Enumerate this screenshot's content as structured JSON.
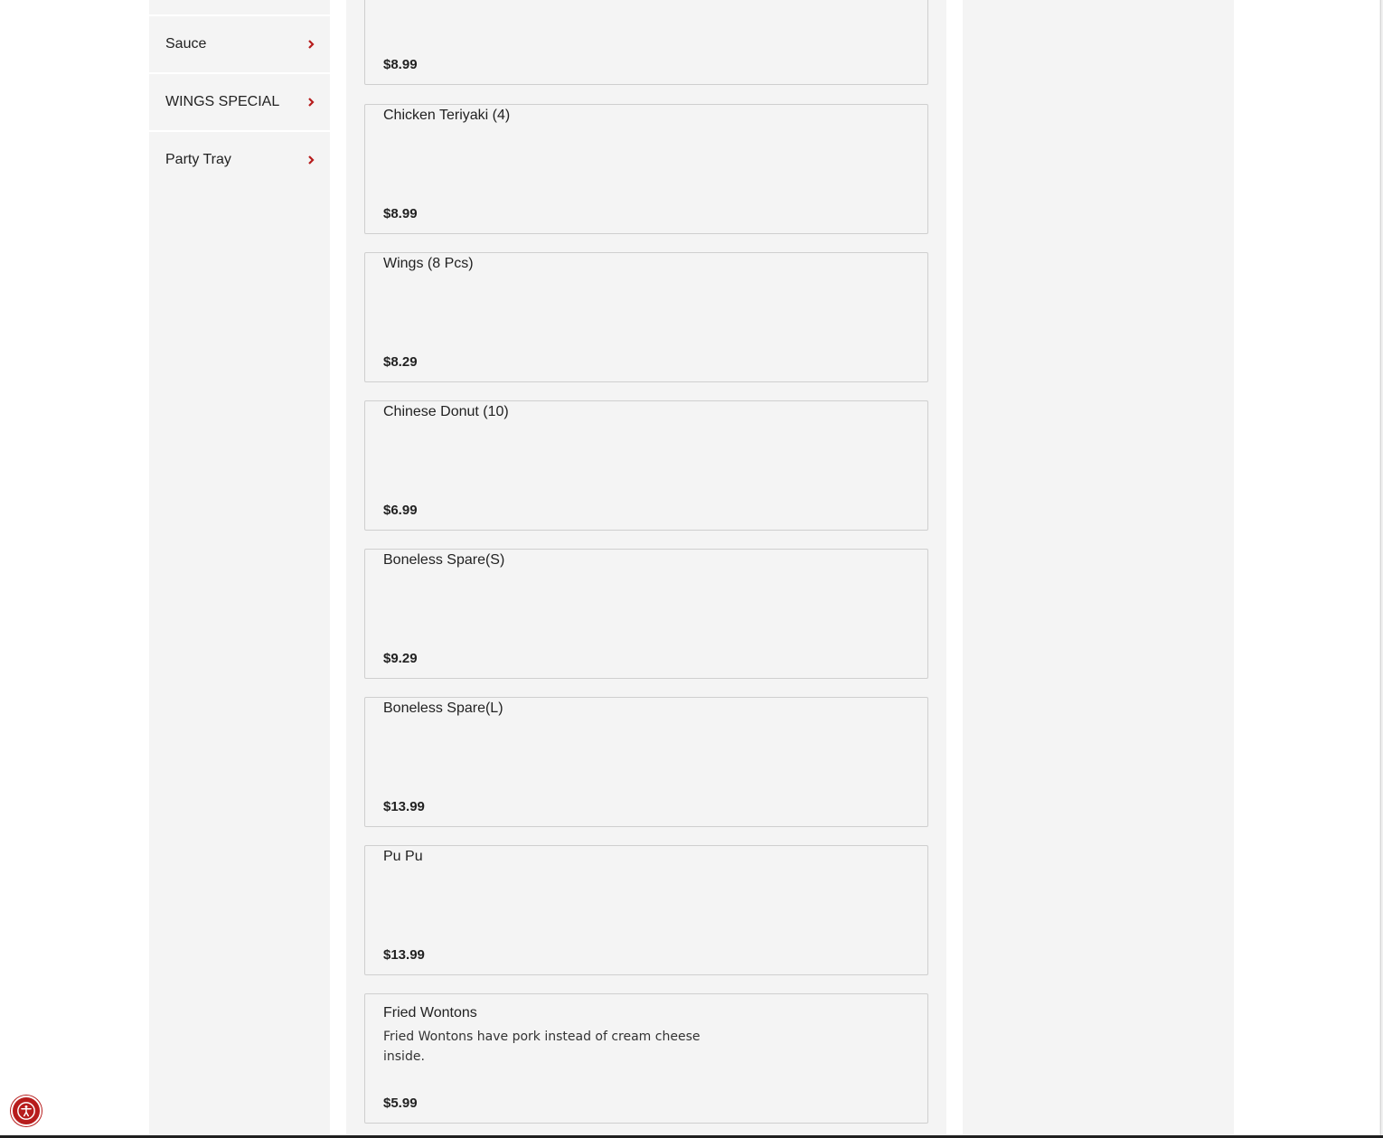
{
  "sidebar": {
    "categories": [
      {
        "label": "Sauce"
      },
      {
        "label": "WINGS SPECIAL"
      },
      {
        "label": "Party Tray"
      }
    ]
  },
  "menu": {
    "items": [
      {
        "name": "",
        "description": "",
        "price": "$8.99"
      },
      {
        "name": "Chicken Teriyaki (4)",
        "description": "",
        "price": "$8.99"
      },
      {
        "name": "Wings (8 Pcs)",
        "description": "",
        "price": "$8.29"
      },
      {
        "name": "Chinese Donut (10)",
        "description": "",
        "price": "$6.99"
      },
      {
        "name": "Boneless Spare(S)",
        "description": "",
        "price": "$9.29"
      },
      {
        "name": "Boneless Spare(L)",
        "description": "",
        "price": "$13.99"
      },
      {
        "name": "Pu Pu",
        "description": "",
        "price": "$13.99"
      },
      {
        "name": "Fried Wontons",
        "description": "Fried Wontons have pork instead of cream cheese inside.",
        "price": "$5.99"
      }
    ]
  },
  "icons": {
    "category_arrow": "chevron-right-icon",
    "accessibility": "accessibility-icon"
  },
  "colors": {
    "accent": "#b71c1c",
    "panel_bg": "#f4f4f4",
    "card_border": "#cfcfcf"
  }
}
